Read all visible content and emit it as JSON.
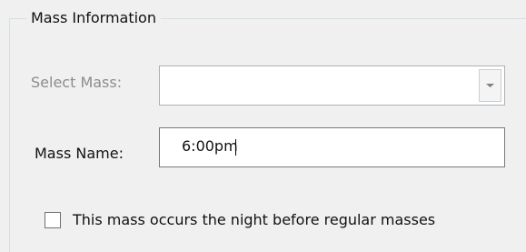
{
  "groupbox": {
    "title": "Mass Information"
  },
  "form": {
    "select_mass": {
      "label": "Select Mass:",
      "value": "",
      "disabled": true
    },
    "mass_name": {
      "label": "Mass Name:",
      "value": "6:00pm"
    },
    "night_before": {
      "label": "This mass occurs the night before regular masses",
      "checked": false
    }
  },
  "icons": {
    "dropdown": "chevron-down-icon"
  },
  "colors": {
    "panel_background": "#f0f0f0",
    "groupbox_border": "#d5dfe5",
    "disabled_text": "#8c8c8c",
    "input_border": "#7a7a7a"
  }
}
